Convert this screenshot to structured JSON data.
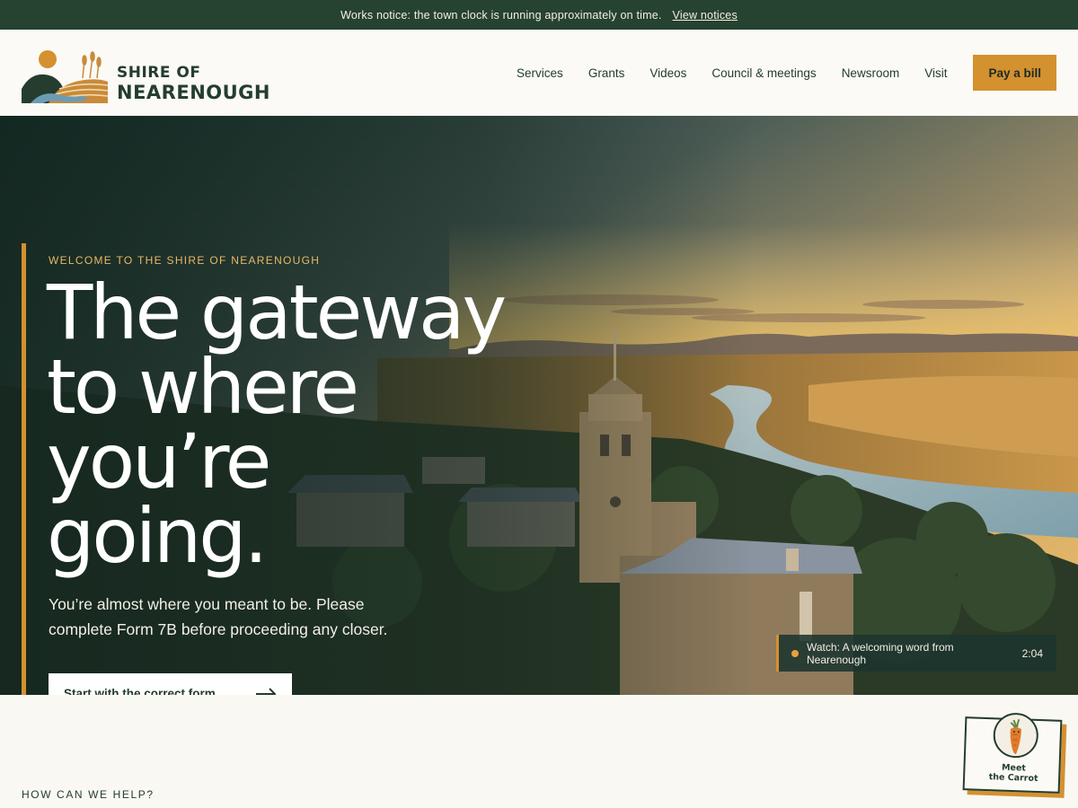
{
  "notice": {
    "text": "Works notice: the town clock is running approximately on time.",
    "link": "View notices"
  },
  "header": {
    "logo_line1": "SHIRE OF",
    "logo_line2": "NEARENOUGH",
    "nav": [
      "Services",
      "Grants",
      "Videos",
      "Council & meetings",
      "Newsroom",
      "Visit"
    ],
    "cta": "Pay a bill"
  },
  "hero": {
    "eyebrow": "WELCOME TO THE SHIRE OF NEARENOUGH",
    "headline_lines": [
      "The gateway",
      "to where",
      "you’re",
      "going."
    ],
    "subcopy": "You’re almost where you meant to be. Please complete Form 7B before proceeding any closer.",
    "cta": "Start with the correct form",
    "video": {
      "label": "Watch: A welcoming word from Nearenough",
      "duration": "2:04"
    }
  },
  "help": {
    "label": "HOW CAN WE HELP?"
  },
  "badge": {
    "line1": "Meet",
    "line2": "the Carrot"
  },
  "colors": {
    "brand_green": "#243d2f",
    "notice_green": "#264231",
    "accent_gold": "#d4912f",
    "page_bg": "#faf8f3"
  }
}
